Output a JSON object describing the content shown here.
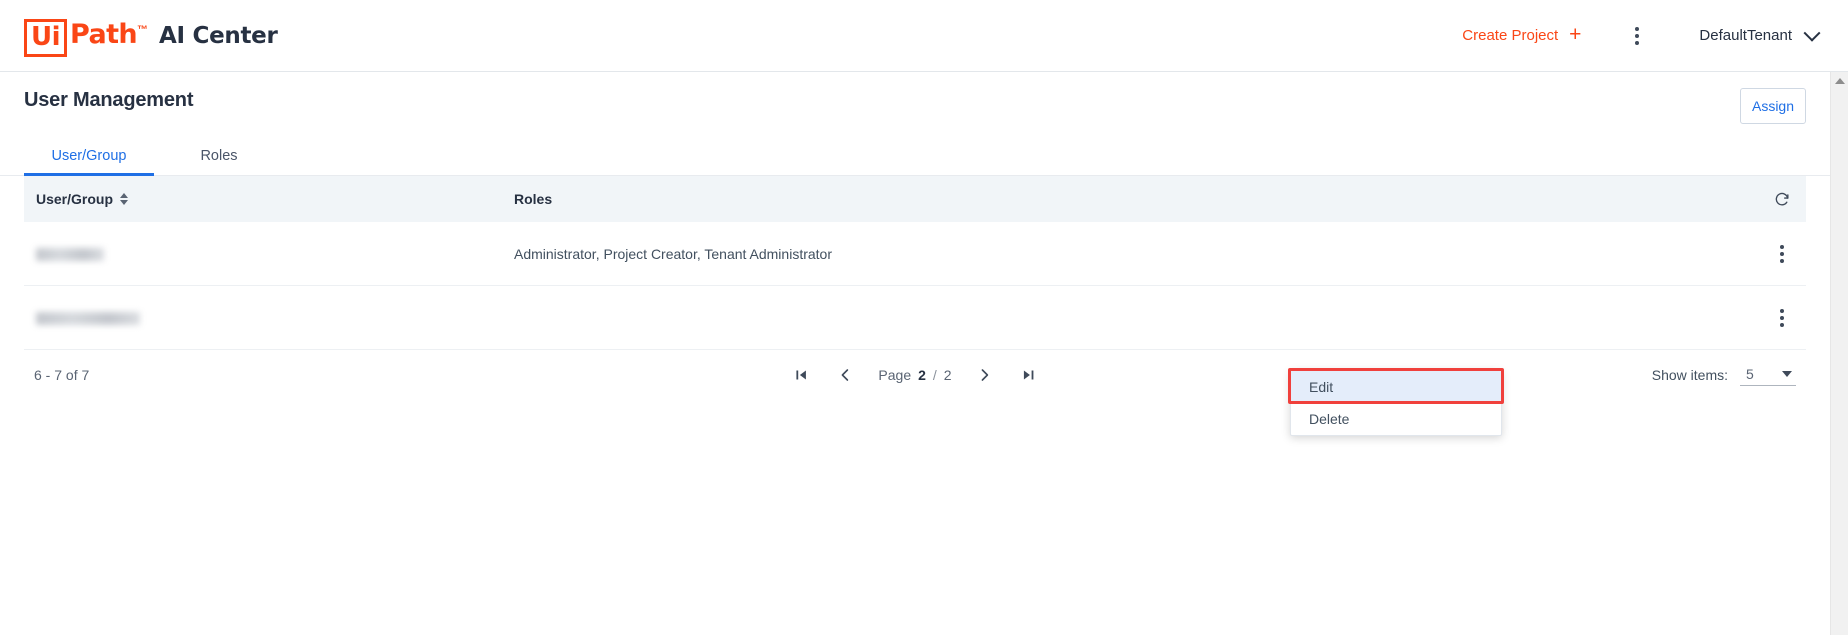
{
  "header": {
    "logo": {
      "ui": "Ui",
      "path": "Path",
      "tm": "™",
      "icon_name": "uipath-logo"
    },
    "product": "AI Center",
    "create_project": "Create Project",
    "create_project_icon": "plus-icon",
    "more_icon": "kebab-menu-icon",
    "tenant": "DefaultTenant",
    "tenant_icon": "chevron-down-icon"
  },
  "page": {
    "title": "User Management",
    "assign_label": "Assign"
  },
  "tabs": [
    {
      "label": "User/Group",
      "active": true
    },
    {
      "label": "Roles",
      "active": false
    }
  ],
  "table": {
    "columns": [
      "User/Group",
      "Roles"
    ],
    "sort_icon": "sort-arrows-icon",
    "refresh_icon": "refresh-icon",
    "row_menu_icon": "kebab-menu-icon",
    "rows": [
      {
        "user": "",
        "user_redacted": true,
        "roles": "Administrator, Project Creator, Tenant Administrator"
      },
      {
        "user": "",
        "user_redacted": true,
        "roles": ""
      }
    ]
  },
  "context_menu": {
    "items": [
      {
        "label": "Edit",
        "highlighted": true
      },
      {
        "label": "Delete",
        "highlighted": false
      }
    ],
    "highlight_color": "#f0403c"
  },
  "pagination": {
    "range": "6 - 7 of 7",
    "first_icon": "first-page-icon",
    "prev_icon": "chevron-left-icon",
    "page_word": "Page",
    "current_page": "2",
    "separator": "/",
    "total_pages": "2",
    "next_icon": "chevron-right-icon",
    "last_icon": "last-page-icon",
    "show_items_label": "Show items:",
    "show_items_value": "5",
    "show_items_icon": "caret-down-icon"
  },
  "colors": {
    "brand_orange": "#fa4616",
    "link_blue": "#1f6fe5",
    "header_bg": "#f1f5f8",
    "highlight_red": "#f0403c",
    "menu_highlight_bg": "#e4edfa"
  }
}
